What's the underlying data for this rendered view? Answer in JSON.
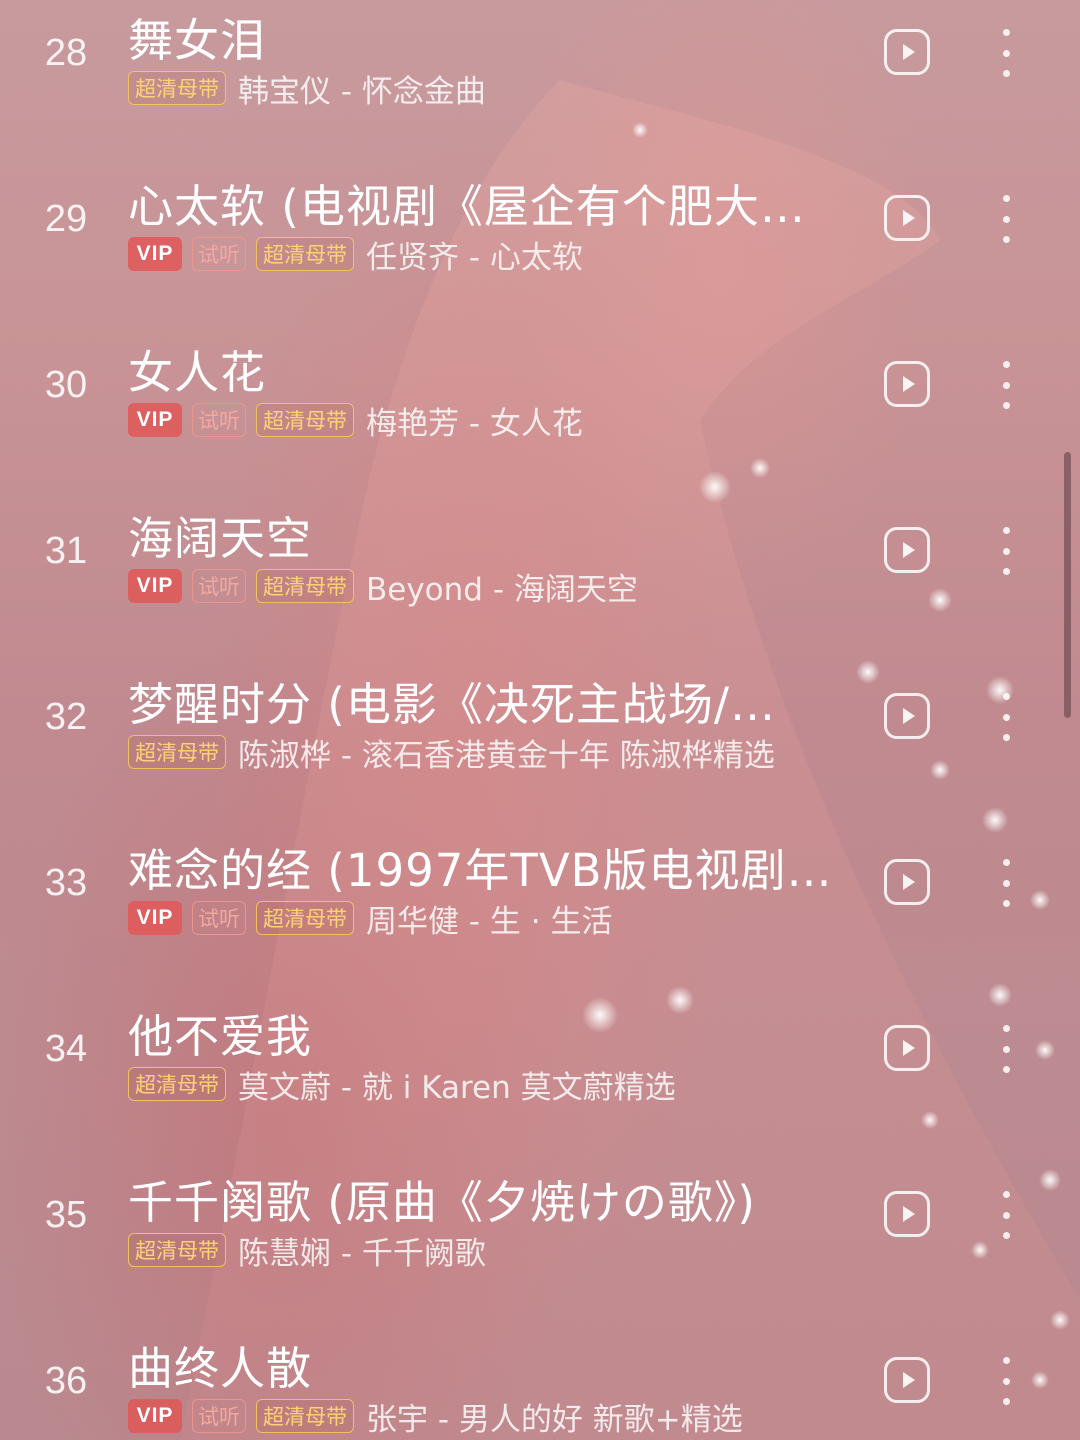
{
  "tags": {
    "vip": "VIP",
    "trial": "试听",
    "hq": "超清母带"
  },
  "icons": {
    "play": "play-square-icon",
    "more": "vertical-dots-icon"
  },
  "colors": {
    "vip_bg": "#e25656",
    "hq_border": "#f6c460",
    "trial_text": "#f6aaa0"
  },
  "songs": [
    {
      "index": "28",
      "title": "舞女泪",
      "vip": false,
      "trial": false,
      "hq": true,
      "artist": "韩宝仪 - 怀念金曲"
    },
    {
      "index": "29",
      "title": "心太软 (电视剧《屋企有个肥大…",
      "vip": true,
      "trial": true,
      "hq": true,
      "artist": "任贤齐 - 心太软"
    },
    {
      "index": "30",
      "title": "女人花",
      "vip": true,
      "trial": true,
      "hq": true,
      "artist": "梅艳芳 - 女人花"
    },
    {
      "index": "31",
      "title": "海阔天空",
      "vip": true,
      "trial": true,
      "hq": true,
      "artist": "Beyond - 海阔天空"
    },
    {
      "index": "32",
      "title": "梦醒时分 (电影《决死主战场/…",
      "vip": false,
      "trial": false,
      "hq": true,
      "artist": "陈淑桦 - 滚石香港黄金十年 陈淑桦精选"
    },
    {
      "index": "33",
      "title": "难念的经 (1997年TVB版电视剧…",
      "vip": true,
      "trial": true,
      "hq": true,
      "artist": "周华健 - 生 · 生活"
    },
    {
      "index": "34",
      "title": "他不爱我",
      "vip": false,
      "trial": false,
      "hq": true,
      "artist": "莫文蔚 - 就 i Karen 莫文蔚精选"
    },
    {
      "index": "35",
      "title": "千千阕歌 (原曲《夕焼けの歌》)",
      "vip": false,
      "trial": false,
      "hq": true,
      "artist": "陈慧娴 - 千千阙歌"
    },
    {
      "index": "36",
      "title": "曲终人散",
      "vip": true,
      "trial": true,
      "hq": true,
      "artist": "张宇 - 男人的好 新歌+精选"
    }
  ]
}
